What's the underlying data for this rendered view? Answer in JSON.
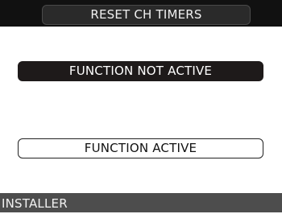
{
  "header": {
    "title": "RESET CH TIMERS"
  },
  "options": [
    {
      "label": "FUNCTION NOT ACTIVE",
      "selected": true
    },
    {
      "label": "FUNCTION ACTIVE",
      "selected": false
    }
  ],
  "footer": {
    "label": "INSTALLER"
  },
  "colors": {
    "background": "#ffffff",
    "header_bar": "#111111",
    "selected_option": "#1e1a1a",
    "footer_bar": "#4d4d4d"
  }
}
